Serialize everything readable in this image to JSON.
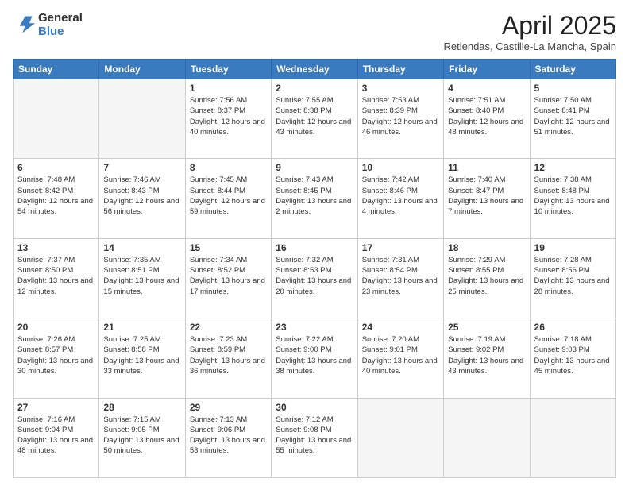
{
  "header": {
    "logo_general": "General",
    "logo_blue": "Blue",
    "month_title": "April 2025",
    "subtitle": "Retiendas, Castille-La Mancha, Spain"
  },
  "days_of_week": [
    "Sunday",
    "Monday",
    "Tuesday",
    "Wednesday",
    "Thursday",
    "Friday",
    "Saturday"
  ],
  "weeks": [
    [
      {
        "day": "",
        "empty": true
      },
      {
        "day": "",
        "empty": true
      },
      {
        "day": "1",
        "sunrise": "7:56 AM",
        "sunset": "8:37 PM",
        "daylight": "12 hours and 40 minutes."
      },
      {
        "day": "2",
        "sunrise": "7:55 AM",
        "sunset": "8:38 PM",
        "daylight": "12 hours and 43 minutes."
      },
      {
        "day": "3",
        "sunrise": "7:53 AM",
        "sunset": "8:39 PM",
        "daylight": "12 hours and 46 minutes."
      },
      {
        "day": "4",
        "sunrise": "7:51 AM",
        "sunset": "8:40 PM",
        "daylight": "12 hours and 48 minutes."
      },
      {
        "day": "5",
        "sunrise": "7:50 AM",
        "sunset": "8:41 PM",
        "daylight": "12 hours and 51 minutes."
      }
    ],
    [
      {
        "day": "6",
        "sunrise": "7:48 AM",
        "sunset": "8:42 PM",
        "daylight": "12 hours and 54 minutes."
      },
      {
        "day": "7",
        "sunrise": "7:46 AM",
        "sunset": "8:43 PM",
        "daylight": "12 hours and 56 minutes."
      },
      {
        "day": "8",
        "sunrise": "7:45 AM",
        "sunset": "8:44 PM",
        "daylight": "12 hours and 59 minutes."
      },
      {
        "day": "9",
        "sunrise": "7:43 AM",
        "sunset": "8:45 PM",
        "daylight": "13 hours and 2 minutes."
      },
      {
        "day": "10",
        "sunrise": "7:42 AM",
        "sunset": "8:46 PM",
        "daylight": "13 hours and 4 minutes."
      },
      {
        "day": "11",
        "sunrise": "7:40 AM",
        "sunset": "8:47 PM",
        "daylight": "13 hours and 7 minutes."
      },
      {
        "day": "12",
        "sunrise": "7:38 AM",
        "sunset": "8:48 PM",
        "daylight": "13 hours and 10 minutes."
      }
    ],
    [
      {
        "day": "13",
        "sunrise": "7:37 AM",
        "sunset": "8:50 PM",
        "daylight": "13 hours and 12 minutes."
      },
      {
        "day": "14",
        "sunrise": "7:35 AM",
        "sunset": "8:51 PM",
        "daylight": "13 hours and 15 minutes."
      },
      {
        "day": "15",
        "sunrise": "7:34 AM",
        "sunset": "8:52 PM",
        "daylight": "13 hours and 17 minutes."
      },
      {
        "day": "16",
        "sunrise": "7:32 AM",
        "sunset": "8:53 PM",
        "daylight": "13 hours and 20 minutes."
      },
      {
        "day": "17",
        "sunrise": "7:31 AM",
        "sunset": "8:54 PM",
        "daylight": "13 hours and 23 minutes."
      },
      {
        "day": "18",
        "sunrise": "7:29 AM",
        "sunset": "8:55 PM",
        "daylight": "13 hours and 25 minutes."
      },
      {
        "day": "19",
        "sunrise": "7:28 AM",
        "sunset": "8:56 PM",
        "daylight": "13 hours and 28 minutes."
      }
    ],
    [
      {
        "day": "20",
        "sunrise": "7:26 AM",
        "sunset": "8:57 PM",
        "daylight": "13 hours and 30 minutes."
      },
      {
        "day": "21",
        "sunrise": "7:25 AM",
        "sunset": "8:58 PM",
        "daylight": "13 hours and 33 minutes."
      },
      {
        "day": "22",
        "sunrise": "7:23 AM",
        "sunset": "8:59 PM",
        "daylight": "13 hours and 36 minutes."
      },
      {
        "day": "23",
        "sunrise": "7:22 AM",
        "sunset": "9:00 PM",
        "daylight": "13 hours and 38 minutes."
      },
      {
        "day": "24",
        "sunrise": "7:20 AM",
        "sunset": "9:01 PM",
        "daylight": "13 hours and 40 minutes."
      },
      {
        "day": "25",
        "sunrise": "7:19 AM",
        "sunset": "9:02 PM",
        "daylight": "13 hours and 43 minutes."
      },
      {
        "day": "26",
        "sunrise": "7:18 AM",
        "sunset": "9:03 PM",
        "daylight": "13 hours and 45 minutes."
      }
    ],
    [
      {
        "day": "27",
        "sunrise": "7:16 AM",
        "sunset": "9:04 PM",
        "daylight": "13 hours and 48 minutes."
      },
      {
        "day": "28",
        "sunrise": "7:15 AM",
        "sunset": "9:05 PM",
        "daylight": "13 hours and 50 minutes."
      },
      {
        "day": "29",
        "sunrise": "7:13 AM",
        "sunset": "9:06 PM",
        "daylight": "13 hours and 53 minutes."
      },
      {
        "day": "30",
        "sunrise": "7:12 AM",
        "sunset": "9:08 PM",
        "daylight": "13 hours and 55 minutes."
      },
      {
        "day": "",
        "empty": true
      },
      {
        "day": "",
        "empty": true
      },
      {
        "day": "",
        "empty": true
      }
    ]
  ]
}
